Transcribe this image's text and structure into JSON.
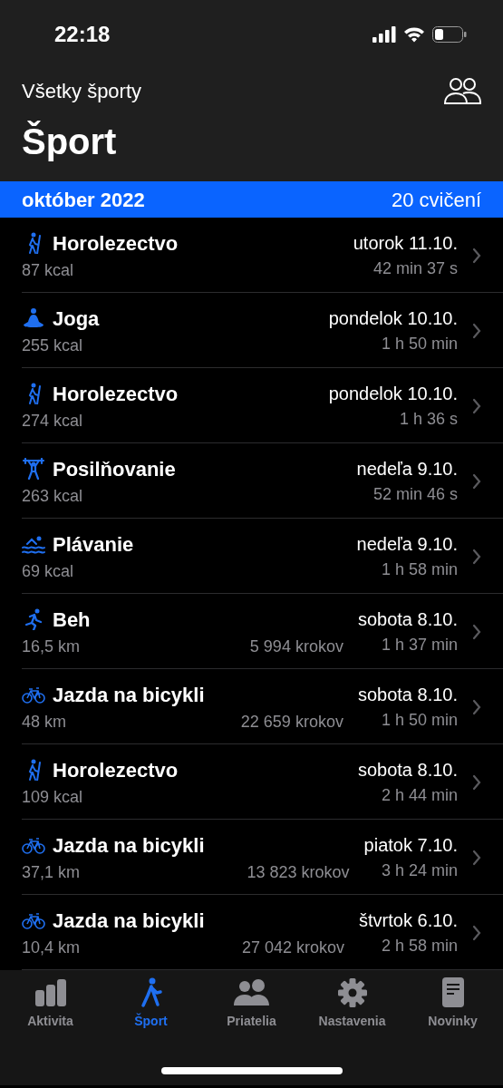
{
  "status_bar": {
    "time": "22:18"
  },
  "nav": {
    "back_label": "Všetky športy",
    "title": "Šport"
  },
  "section": {
    "month": "október 2022",
    "count": "20 cvičení"
  },
  "workouts": [
    {
      "kind": "hiking",
      "name": "Horolezectvo",
      "stat": "87 kcal",
      "date": "utorok 11.10.",
      "duration": "42 min 37 s"
    },
    {
      "kind": "yoga",
      "name": "Joga",
      "stat": "255 kcal",
      "date": "pondelok 10.10.",
      "duration": "1 h 50 min"
    },
    {
      "kind": "hiking",
      "name": "Horolezectvo",
      "stat": "274 kcal",
      "date": "pondelok 10.10.",
      "duration": "1 h 36 s"
    },
    {
      "kind": "strength",
      "name": "Posilňovanie",
      "stat": "263 kcal",
      "date": "nedeľa 9.10.",
      "duration": "52 min 46 s"
    },
    {
      "kind": "swimming",
      "name": "Plávanie",
      "stat": "69 kcal",
      "date": "nedeľa 9.10.",
      "duration": "1 h 58 min"
    },
    {
      "kind": "running",
      "name": "Beh",
      "stat": "16,5 km",
      "steps": "5 994 krokov",
      "date": "sobota 8.10.",
      "duration": "1 h 37 min"
    },
    {
      "kind": "cycling",
      "name": "Jazda na bicykli",
      "stat": "48 km",
      "steps": "22 659 krokov",
      "date": "sobota 8.10.",
      "duration": "1 h 50 min"
    },
    {
      "kind": "hiking",
      "name": "Horolezectvo",
      "stat": "109 kcal",
      "date": "sobota 8.10.",
      "duration": "2 h 44 min"
    },
    {
      "kind": "cycling",
      "name": "Jazda na bicykli",
      "stat": "37,1 km",
      "steps": "13 823 krokov",
      "date": "piatok 7.10.",
      "duration": "3 h 24 min"
    },
    {
      "kind": "cycling",
      "name": "Jazda na bicykli",
      "stat": "10,4 km",
      "steps": "27 042 krokov",
      "date": "štvrtok 6.10.",
      "duration": "2 h 58 min"
    }
  ],
  "tab_bar": [
    {
      "kind": "activity",
      "label": "Aktivita",
      "selected": false
    },
    {
      "kind": "sport",
      "label": "Šport",
      "selected": true
    },
    {
      "kind": "friends",
      "label": "Priatelia",
      "selected": false
    },
    {
      "kind": "settings",
      "label": "Nastavenia",
      "selected": false
    },
    {
      "kind": "news",
      "label": "Novinky",
      "selected": false
    }
  ]
}
